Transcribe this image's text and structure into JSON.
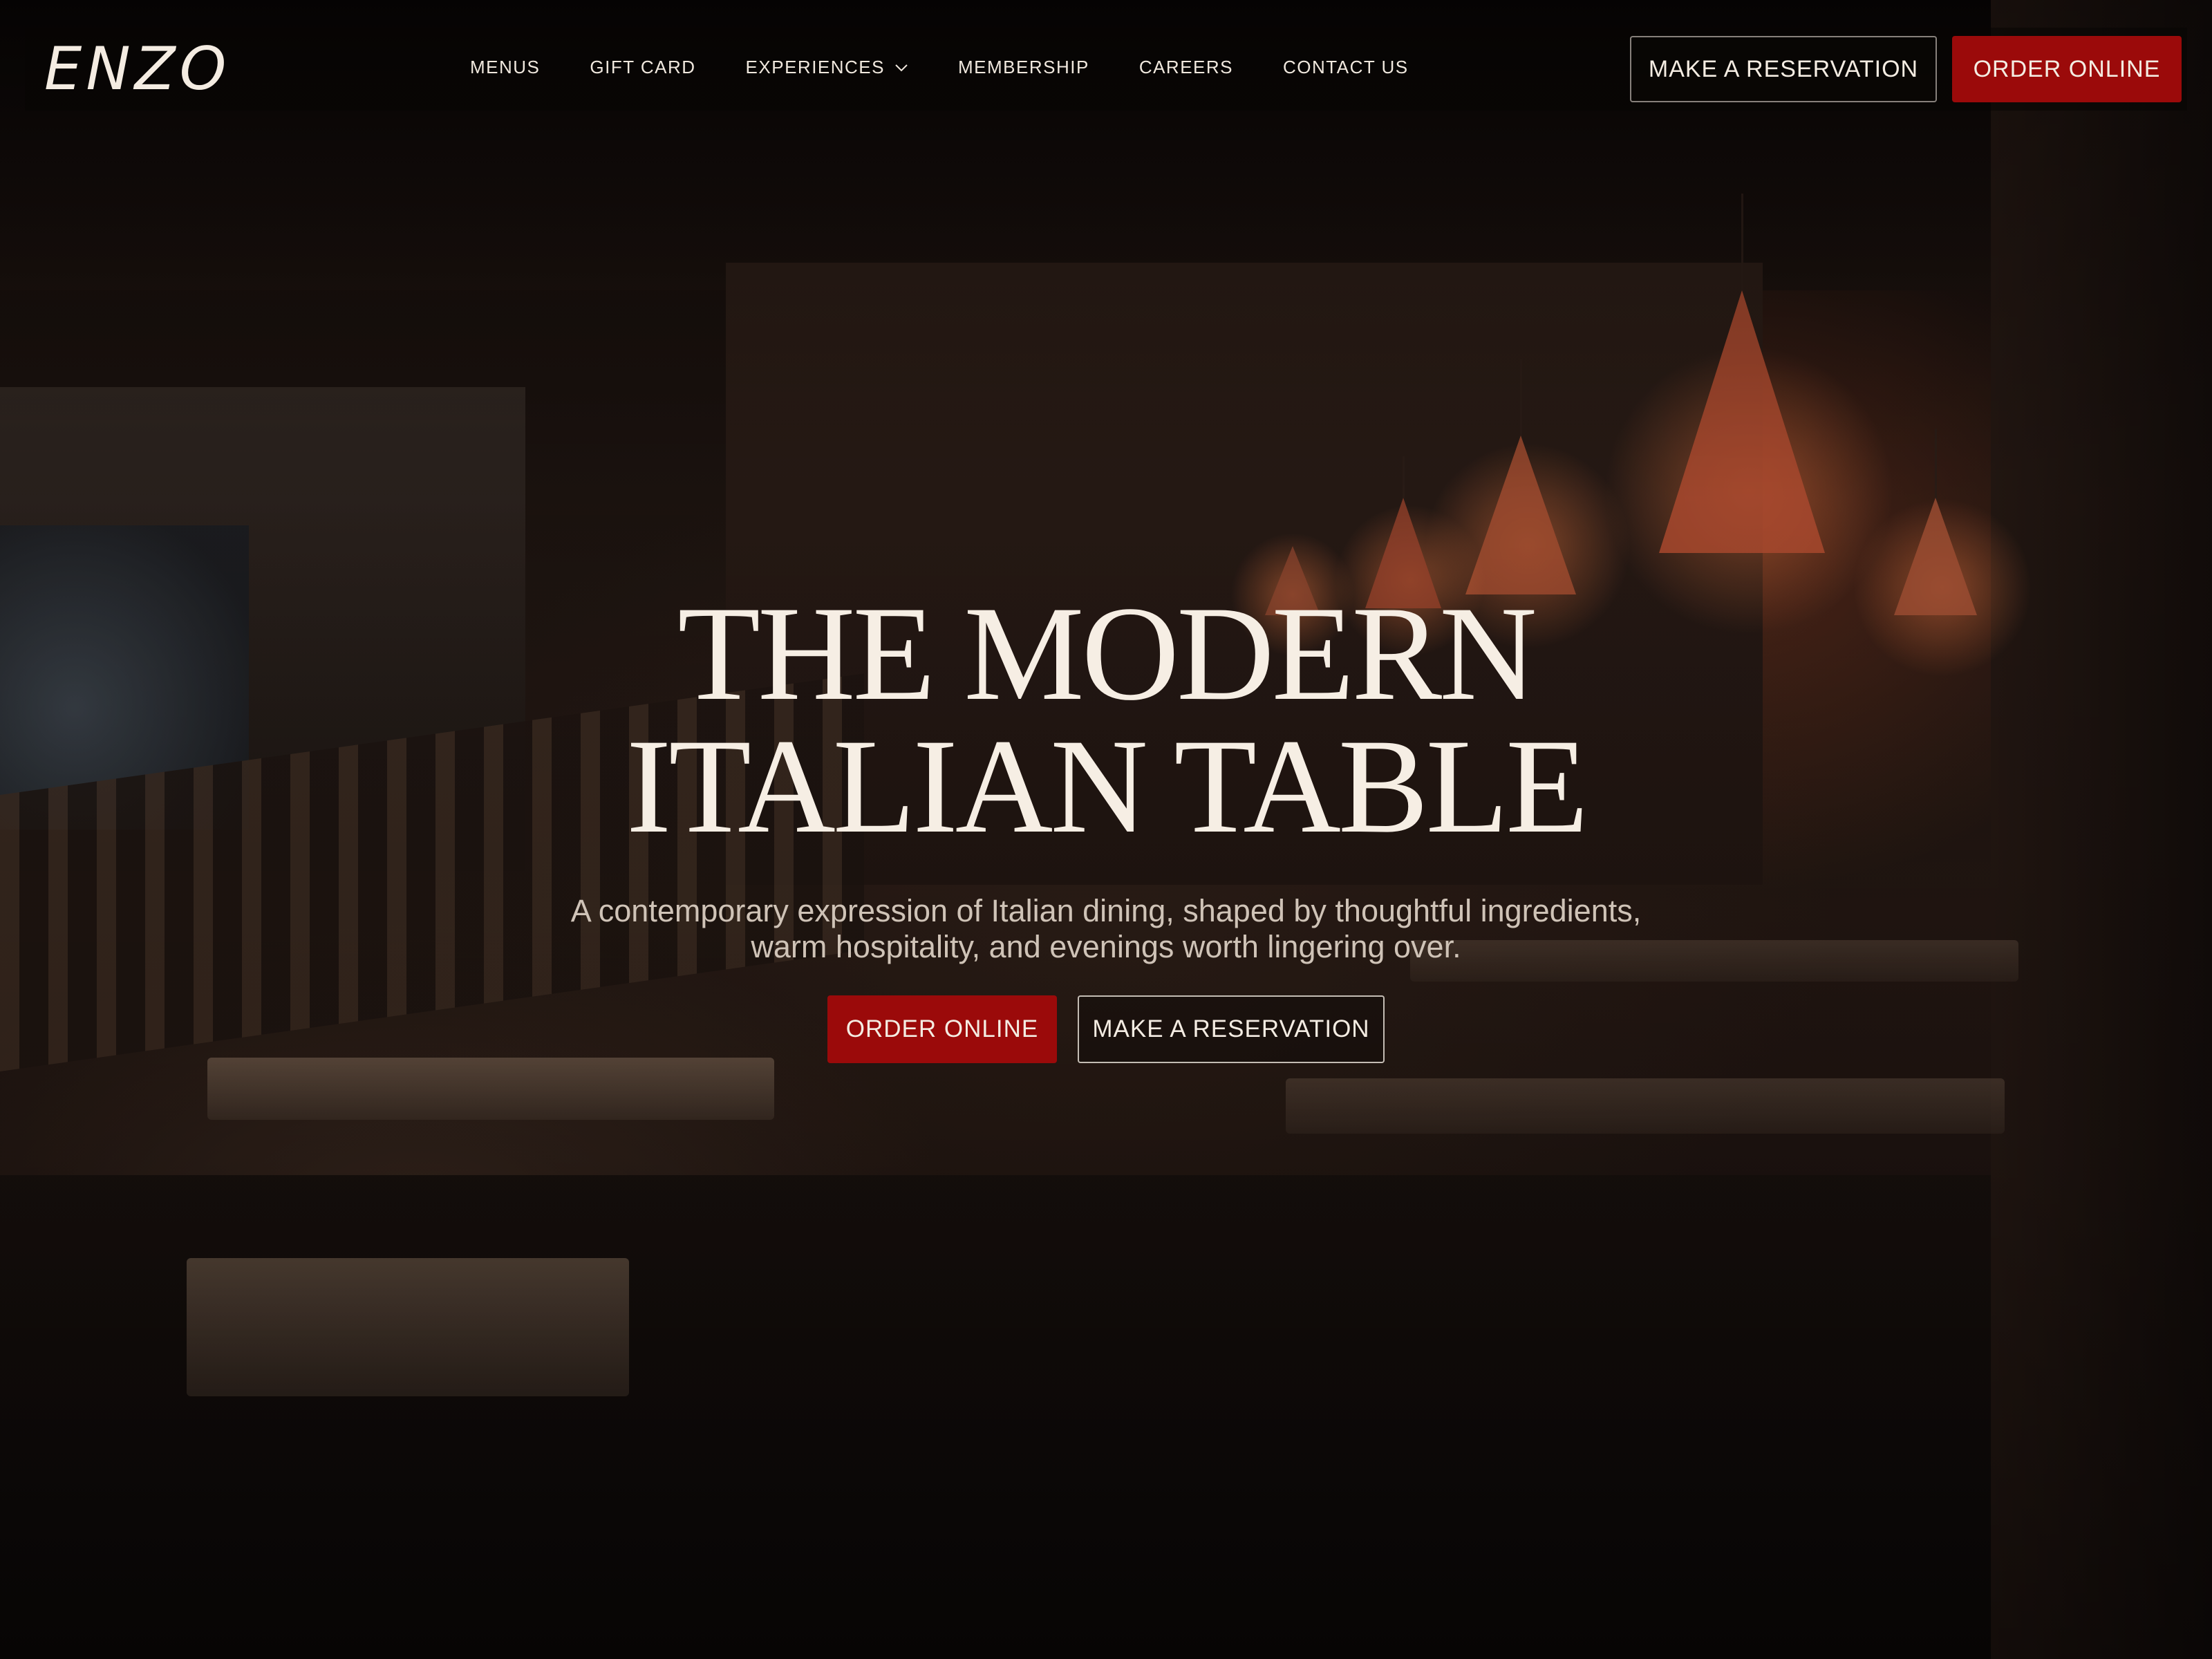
{
  "brand": {
    "logo_text": "ENZO"
  },
  "nav": {
    "links": [
      {
        "label": "MENUS"
      },
      {
        "label": "GIFT CARD"
      },
      {
        "label": "EXPERIENCES",
        "has_dropdown": true
      },
      {
        "label": "MEMBERSHIP"
      },
      {
        "label": "CAREERS"
      },
      {
        "label": "CONTACT US"
      }
    ],
    "reserve_label": "MAKE A RESERVATION",
    "order_label": "ORDER ONLINE"
  },
  "hero": {
    "headline_line1": "THE MODERN",
    "headline_line2": "ITALIAN TABLE",
    "subtitle_line1": "A contemporary expression of Italian dining, shaped by thoughtful ingredients,",
    "subtitle_line2": "warm hospitality, and evenings worth lingering over.",
    "order_label": "ORDER ONLINE",
    "reserve_label": "MAKE A RESERVATION"
  },
  "icons": {
    "dropdown": "chevron-down-icon"
  },
  "colors": {
    "accent": "#9b0a0a",
    "text": "#f4ece2",
    "background": "#0b0706"
  }
}
